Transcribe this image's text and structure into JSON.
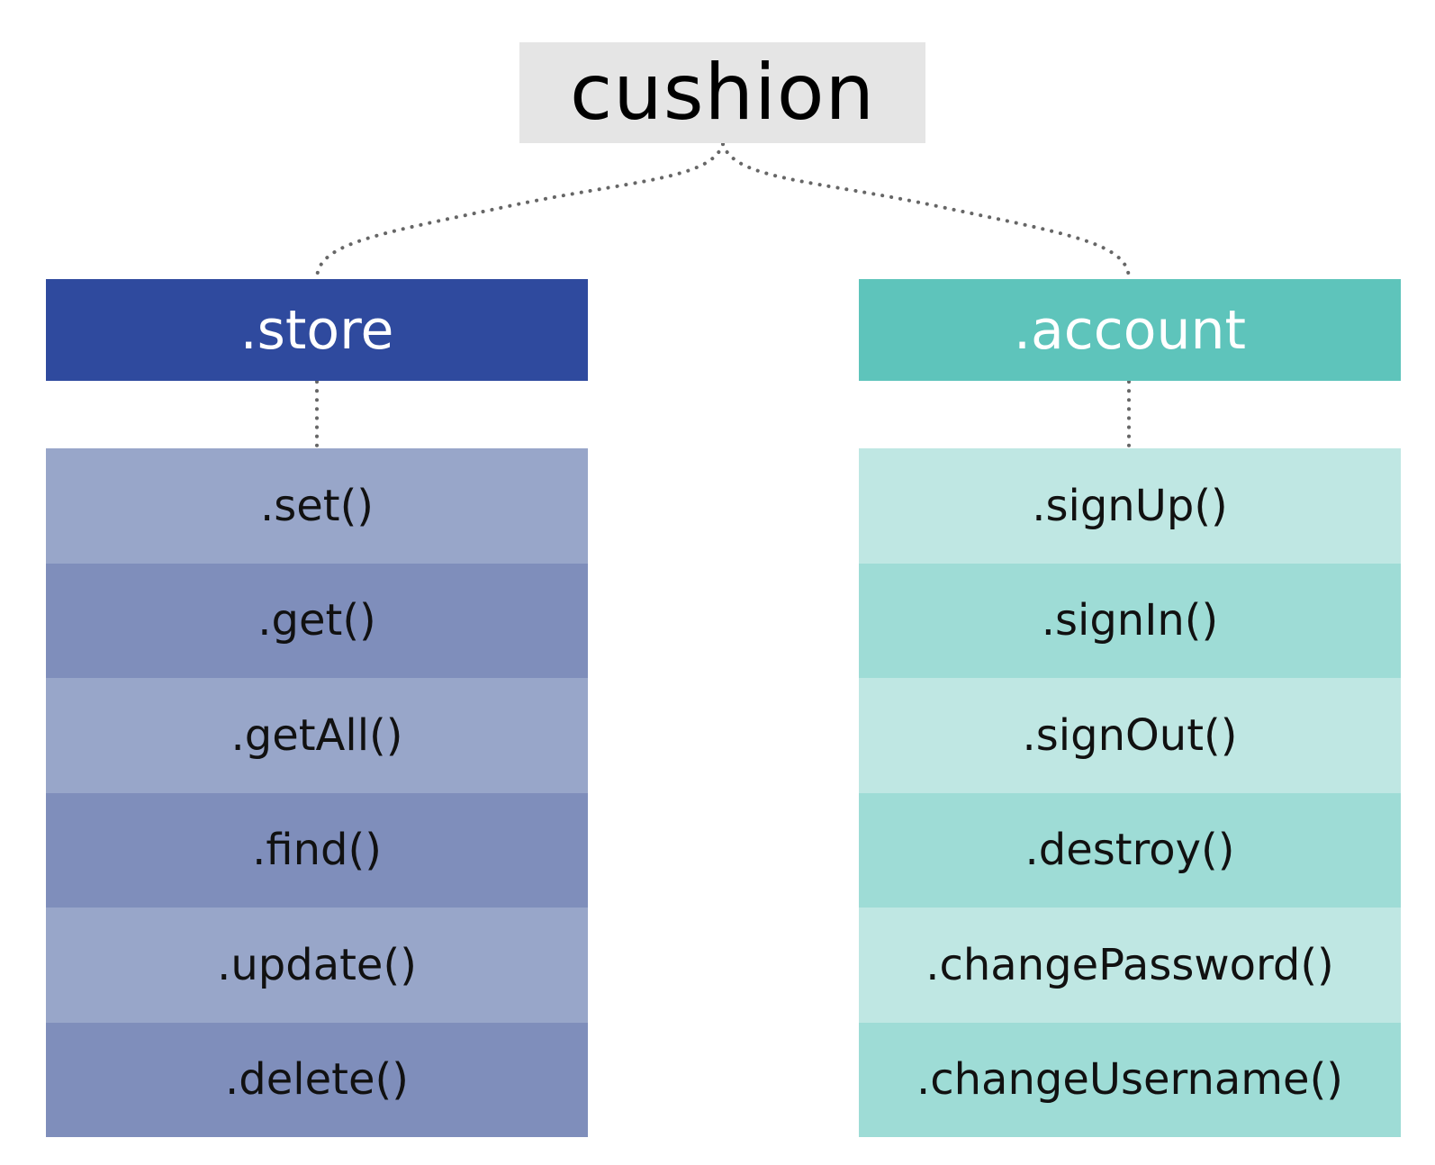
{
  "root": {
    "label": "cushion",
    "color": "#e5e5e5"
  },
  "branches": [
    {
      "label": ".store",
      "header_color": "#2f4a9e",
      "row_colors": [
        "#98a6c9",
        "#7f8ebb"
      ],
      "methods": [
        ".set()",
        ".get()",
        ".getAll()",
        ".find()",
        ".update()",
        ".delete()"
      ]
    },
    {
      "label": ".account",
      "header_color": "#5ec4bb",
      "row_colors": [
        "#bfe7e3",
        "#9edcd6"
      ],
      "methods": [
        ".signUp()",
        ".signIn()",
        ".signOut()",
        ".destroy()",
        ".changePassword()",
        ".changeUsername()"
      ]
    }
  ],
  "connector_color": "#666666"
}
